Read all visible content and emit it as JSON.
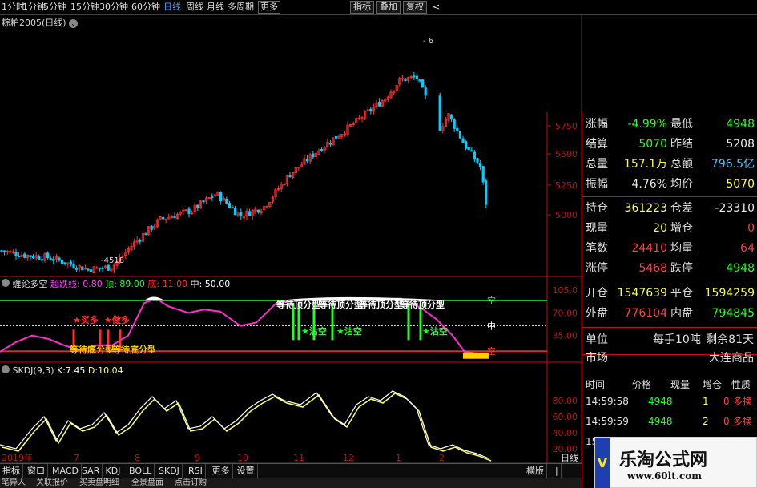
{
  "toolbar": {
    "periods": [
      "1分时",
      "1分钟",
      "5分钟",
      "15分钟",
      "30分钟",
      "60分钟",
      "日线",
      "周线",
      "月线",
      "多周期",
      "更多"
    ],
    "active_period": "日线",
    "buttons": [
      "指标",
      "叠加",
      "复权"
    ],
    "back": "<"
  },
  "main_chart": {
    "title": "粽粕2005(日线)",
    "y_ticks": [
      "5750",
      "5500",
      "5250",
      "5000"
    ],
    "high_label": "6",
    "low_label": "4518"
  },
  "indicator1": {
    "name": "缠论多空",
    "fields": [
      {
        "label": "超跌线",
        "value": "0.80",
        "color": "#ff3cff"
      },
      {
        "label": "顶",
        "value": "89.00",
        "color": "#22ff22"
      },
      {
        "label": "底",
        "value": "11.00",
        "color": "#ff3030"
      },
      {
        "label": "中",
        "value": "50.00",
        "color": "#ffffff"
      }
    ],
    "y_ticks": [
      "105.0",
      "70.00",
      "35.00"
    ],
    "right_labels": {
      "top": "空",
      "mid": "中",
      "bottom": "空"
    },
    "annotations": {
      "buy_signals": [
        "★买多",
        "★做多"
      ],
      "bottom_pattern": "等待底分型",
      "top_pattern": "等待顶分型",
      "short_signal": "★沽空"
    }
  },
  "indicator2": {
    "name": "SKDJ(9,3)",
    "k_label": "K:",
    "k_value": "7.45",
    "d_label": "D:",
    "d_value": "10.04",
    "y_ticks": [
      "80.00",
      "60.00",
      "40.00",
      "20.00"
    ]
  },
  "x_axis": [
    "2019年",
    "7",
    "8",
    "9",
    "10",
    "11",
    "12",
    "1",
    "2"
  ],
  "period_badge": "日线",
  "quote": {
    "rows": [
      {
        "l1": "涨幅",
        "v1": "-4.99%",
        "c1": "#22ff22",
        "l2": "最低",
        "v2": "4948",
        "c2": "#22ff22"
      },
      {
        "l1": "结算",
        "v1": "5070",
        "c1": "#22ff22",
        "l2": "昨结",
        "v2": "5208",
        "c2": "#e8e8e8"
      },
      {
        "l1": "总量",
        "v1": "157.1万",
        "c1": "#ffff44",
        "l2": "总额",
        "v2": "796.5亿",
        "c2": "#4ec5ff"
      },
      {
        "l1": "振幅",
        "v1": "4.76%",
        "c1": "#e8e8e8",
        "l2": "均价",
        "v2": "5070",
        "c2": "#ffff44"
      },
      {
        "l1": "持仓",
        "v1": "361223",
        "c1": "#ffff44",
        "l2": "仓差",
        "v2": "-23310",
        "c2": "#e8e8e8"
      },
      {
        "l1": "现量",
        "v1": "20",
        "c1": "#ffff44",
        "l2": "增仓",
        "v2": "0",
        "c2": "#ff4040"
      },
      {
        "l1": "笔数",
        "v1": "24410",
        "c1": "#ff4040",
        "l2": "均量",
        "v2": "64",
        "c2": "#ff4040"
      },
      {
        "l1": "涨停",
        "v1": "5468",
        "c1": "#ff4040",
        "l2": "跌停",
        "v2": "4948",
        "c2": "#22ff22"
      },
      {
        "l1": "开仓",
        "v1": "1547639",
        "c1": "#ffff44",
        "l2": "平仓",
        "v2": "1594259",
        "c2": "#ffff44"
      },
      {
        "l1": "外盘",
        "v1": "776104",
        "c1": "#ff4040",
        "l2": "内盘",
        "v2": "794845",
        "c2": "#22ff22"
      }
    ],
    "unit_label": "单位",
    "unit_value": "每手10吨",
    "remain": "剩余81天",
    "market_label": "市场",
    "market_value": "大连商品"
  },
  "trades": {
    "headers": [
      "时间",
      "价格",
      "现量",
      "增仓",
      "性质"
    ],
    "rows": [
      {
        "time": "14:59:58",
        "price": "4948",
        "vol": "1",
        "oi": "0",
        "type": "多换"
      },
      {
        "time": "14:59:59",
        "price": "4948",
        "vol": "2",
        "oi": "0",
        "type": "多换"
      },
      {
        "time": "15:00:00",
        "price": "4948",
        "vol": "",
        "oi": "",
        "type": ""
      }
    ]
  },
  "bottom_tabs": [
    "指标",
    "窗口",
    "MACD",
    "SAR",
    "KDJ",
    "BOLL",
    "SKDJ",
    "RSI",
    "更多",
    "设置"
  ],
  "bottom_right": [
    "横版",
    "|"
  ],
  "footer_tabs": [
    "笔异人",
    "关联报价",
    "买卖盘明细",
    "全景盘面",
    "点击订购"
  ],
  "watermark": {
    "title": "乐淘公式网",
    "url": "www.60lt.com",
    "side": "V"
  },
  "colors": {
    "up": "#ff3030",
    "down": "#00d0ff",
    "panel_border": "#c01010",
    "k_line": "#ffffff",
    "d_line": "#ffff66",
    "curve": "#ff2ad0",
    "signal": "#22ff22"
  }
}
